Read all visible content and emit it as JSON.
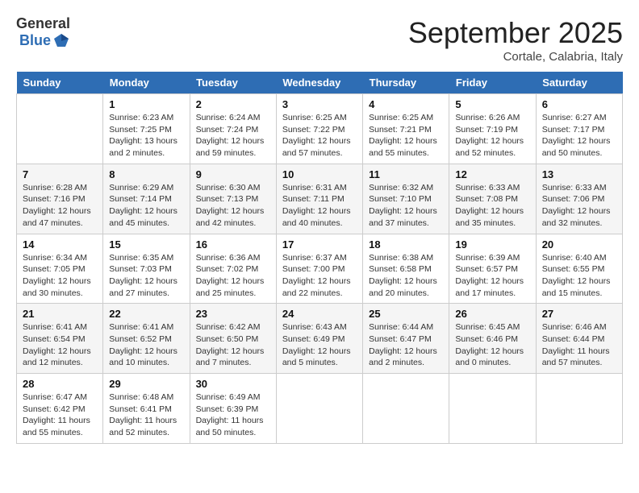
{
  "header": {
    "logo_general": "General",
    "logo_blue": "Blue",
    "month_title": "September 2025",
    "location": "Cortale, Calabria, Italy"
  },
  "days_of_week": [
    "Sunday",
    "Monday",
    "Tuesday",
    "Wednesday",
    "Thursday",
    "Friday",
    "Saturday"
  ],
  "weeks": [
    [
      {
        "day": null,
        "sunrise": null,
        "sunset": null,
        "daylight": null
      },
      {
        "day": "1",
        "sunrise": "Sunrise: 6:23 AM",
        "sunset": "Sunset: 7:25 PM",
        "daylight": "Daylight: 13 hours and 2 minutes."
      },
      {
        "day": "2",
        "sunrise": "Sunrise: 6:24 AM",
        "sunset": "Sunset: 7:24 PM",
        "daylight": "Daylight: 12 hours and 59 minutes."
      },
      {
        "day": "3",
        "sunrise": "Sunrise: 6:25 AM",
        "sunset": "Sunset: 7:22 PM",
        "daylight": "Daylight: 12 hours and 57 minutes."
      },
      {
        "day": "4",
        "sunrise": "Sunrise: 6:25 AM",
        "sunset": "Sunset: 7:21 PM",
        "daylight": "Daylight: 12 hours and 55 minutes."
      },
      {
        "day": "5",
        "sunrise": "Sunrise: 6:26 AM",
        "sunset": "Sunset: 7:19 PM",
        "daylight": "Daylight: 12 hours and 52 minutes."
      },
      {
        "day": "6",
        "sunrise": "Sunrise: 6:27 AM",
        "sunset": "Sunset: 7:17 PM",
        "daylight": "Daylight: 12 hours and 50 minutes."
      }
    ],
    [
      {
        "day": "7",
        "sunrise": "Sunrise: 6:28 AM",
        "sunset": "Sunset: 7:16 PM",
        "daylight": "Daylight: 12 hours and 47 minutes."
      },
      {
        "day": "8",
        "sunrise": "Sunrise: 6:29 AM",
        "sunset": "Sunset: 7:14 PM",
        "daylight": "Daylight: 12 hours and 45 minutes."
      },
      {
        "day": "9",
        "sunrise": "Sunrise: 6:30 AM",
        "sunset": "Sunset: 7:13 PM",
        "daylight": "Daylight: 12 hours and 42 minutes."
      },
      {
        "day": "10",
        "sunrise": "Sunrise: 6:31 AM",
        "sunset": "Sunset: 7:11 PM",
        "daylight": "Daylight: 12 hours and 40 minutes."
      },
      {
        "day": "11",
        "sunrise": "Sunrise: 6:32 AM",
        "sunset": "Sunset: 7:10 PM",
        "daylight": "Daylight: 12 hours and 37 minutes."
      },
      {
        "day": "12",
        "sunrise": "Sunrise: 6:33 AM",
        "sunset": "Sunset: 7:08 PM",
        "daylight": "Daylight: 12 hours and 35 minutes."
      },
      {
        "day": "13",
        "sunrise": "Sunrise: 6:33 AM",
        "sunset": "Sunset: 7:06 PM",
        "daylight": "Daylight: 12 hours and 32 minutes."
      }
    ],
    [
      {
        "day": "14",
        "sunrise": "Sunrise: 6:34 AM",
        "sunset": "Sunset: 7:05 PM",
        "daylight": "Daylight: 12 hours and 30 minutes."
      },
      {
        "day": "15",
        "sunrise": "Sunrise: 6:35 AM",
        "sunset": "Sunset: 7:03 PM",
        "daylight": "Daylight: 12 hours and 27 minutes."
      },
      {
        "day": "16",
        "sunrise": "Sunrise: 6:36 AM",
        "sunset": "Sunset: 7:02 PM",
        "daylight": "Daylight: 12 hours and 25 minutes."
      },
      {
        "day": "17",
        "sunrise": "Sunrise: 6:37 AM",
        "sunset": "Sunset: 7:00 PM",
        "daylight": "Daylight: 12 hours and 22 minutes."
      },
      {
        "day": "18",
        "sunrise": "Sunrise: 6:38 AM",
        "sunset": "Sunset: 6:58 PM",
        "daylight": "Daylight: 12 hours and 20 minutes."
      },
      {
        "day": "19",
        "sunrise": "Sunrise: 6:39 AM",
        "sunset": "Sunset: 6:57 PM",
        "daylight": "Daylight: 12 hours and 17 minutes."
      },
      {
        "day": "20",
        "sunrise": "Sunrise: 6:40 AM",
        "sunset": "Sunset: 6:55 PM",
        "daylight": "Daylight: 12 hours and 15 minutes."
      }
    ],
    [
      {
        "day": "21",
        "sunrise": "Sunrise: 6:41 AM",
        "sunset": "Sunset: 6:54 PM",
        "daylight": "Daylight: 12 hours and 12 minutes."
      },
      {
        "day": "22",
        "sunrise": "Sunrise: 6:41 AM",
        "sunset": "Sunset: 6:52 PM",
        "daylight": "Daylight: 12 hours and 10 minutes."
      },
      {
        "day": "23",
        "sunrise": "Sunrise: 6:42 AM",
        "sunset": "Sunset: 6:50 PM",
        "daylight": "Daylight: 12 hours and 7 minutes."
      },
      {
        "day": "24",
        "sunrise": "Sunrise: 6:43 AM",
        "sunset": "Sunset: 6:49 PM",
        "daylight": "Daylight: 12 hours and 5 minutes."
      },
      {
        "day": "25",
        "sunrise": "Sunrise: 6:44 AM",
        "sunset": "Sunset: 6:47 PM",
        "daylight": "Daylight: 12 hours and 2 minutes."
      },
      {
        "day": "26",
        "sunrise": "Sunrise: 6:45 AM",
        "sunset": "Sunset: 6:46 PM",
        "daylight": "Daylight: 12 hours and 0 minutes."
      },
      {
        "day": "27",
        "sunrise": "Sunrise: 6:46 AM",
        "sunset": "Sunset: 6:44 PM",
        "daylight": "Daylight: 11 hours and 57 minutes."
      }
    ],
    [
      {
        "day": "28",
        "sunrise": "Sunrise: 6:47 AM",
        "sunset": "Sunset: 6:42 PM",
        "daylight": "Daylight: 11 hours and 55 minutes."
      },
      {
        "day": "29",
        "sunrise": "Sunrise: 6:48 AM",
        "sunset": "Sunset: 6:41 PM",
        "daylight": "Daylight: 11 hours and 52 minutes."
      },
      {
        "day": "30",
        "sunrise": "Sunrise: 6:49 AM",
        "sunset": "Sunset: 6:39 PM",
        "daylight": "Daylight: 11 hours and 50 minutes."
      },
      {
        "day": null,
        "sunrise": null,
        "sunset": null,
        "daylight": null
      },
      {
        "day": null,
        "sunrise": null,
        "sunset": null,
        "daylight": null
      },
      {
        "day": null,
        "sunrise": null,
        "sunset": null,
        "daylight": null
      },
      {
        "day": null,
        "sunrise": null,
        "sunset": null,
        "daylight": null
      }
    ]
  ]
}
